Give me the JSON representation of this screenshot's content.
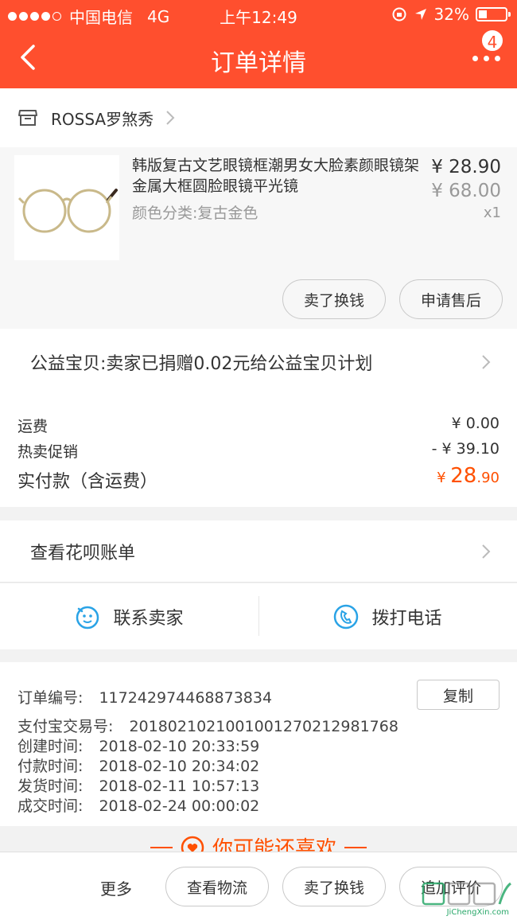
{
  "status_bar": {
    "carrier": "中国电信",
    "network": "4G",
    "time": "上午12:49",
    "battery": "32%",
    "battery_level": 0.32
  },
  "nav": {
    "title": "订单详情",
    "badge": "4"
  },
  "shop": {
    "name": "ROSSA罗煞秀"
  },
  "product": {
    "title": "韩版复古文艺眼镜框潮男女大脸素颜眼镜架金属大框圆脸眼镜平光镜",
    "sku": "颜色分类:复古金色",
    "price": "¥ 28.90",
    "original_price": "¥ 68.00",
    "quantity": "x1",
    "sell_button": "卖了换钱",
    "after_sale_button": "申请售后"
  },
  "charity": {
    "text": "公益宝贝:卖家已捐赠0.02元给公益宝贝计划"
  },
  "costs": {
    "shipping_label": "运费",
    "shipping_value": "¥ 0.00",
    "promo_label": "热卖促销",
    "promo_value": "- ¥ 39.10",
    "total_label": "实付款（含运费）",
    "total_currency": "¥",
    "total_integer": "28",
    "total_decimal": ".90"
  },
  "huabei": {
    "text": "查看花呗账单"
  },
  "contact": {
    "seller": "联系卖家",
    "phone": "拨打电话"
  },
  "order_info": {
    "order_no_label": "订单编号:",
    "order_no": "117242974468873834",
    "copy_button": "复制",
    "alipay_label": "支付宝交易号:",
    "alipay_no": "2018021021001001270212981768",
    "created_label": "创建时间:",
    "created": "2018-02-10 20:33:59",
    "paid_label": "付款时间:",
    "paid": "2018-02-10 20:34:02",
    "shipped_label": "发货时间:",
    "shipped": "2018-02-11 10:57:13",
    "completed_label": "成交时间:",
    "completed": "2018-02-24 00:00:02"
  },
  "recommend": {
    "title": "你可能还喜欢"
  },
  "bottom_bar": {
    "more": "更多",
    "logistics": "查看物流",
    "sell": "卖了换钱",
    "review": "追加评价"
  },
  "watermark": {
    "text": "JiChengXin.com"
  },
  "colors": {
    "brand": "#ff4f2e",
    "price_accent": "#ff5000",
    "icon_blue": "#2aa3e6"
  }
}
